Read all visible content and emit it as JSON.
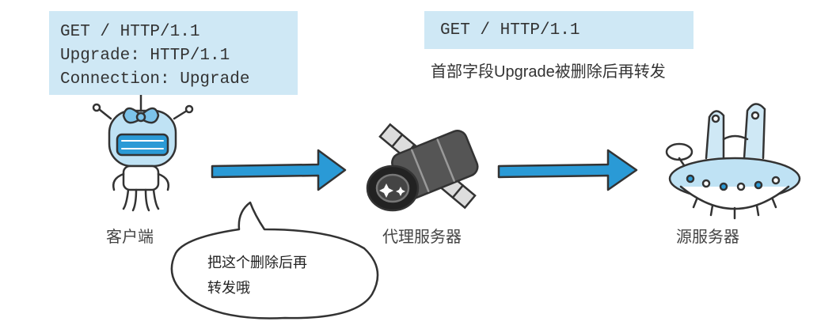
{
  "client_request": {
    "lines": [
      "GET / HTTP/1.1",
      "Upgrade: HTTP/1.1",
      "Connection: Upgrade"
    ]
  },
  "forwarded_request": {
    "line": "GET / HTTP/1.1",
    "note": "首部字段Upgrade被删除后再转发"
  },
  "nodes": {
    "client": "客户端",
    "proxy": "代理服务器",
    "origin": "源服务器"
  },
  "speech_bubble": {
    "line1": "把这个删除后再",
    "line2": "转发哦"
  },
  "colors": {
    "box_fill": "#cfe8f5",
    "arrow": "#2a9ad6",
    "outline": "#333333"
  },
  "icons": [
    "robot-client-icon",
    "satellite-proxy-icon",
    "ufo-origin-server-icon"
  ]
}
